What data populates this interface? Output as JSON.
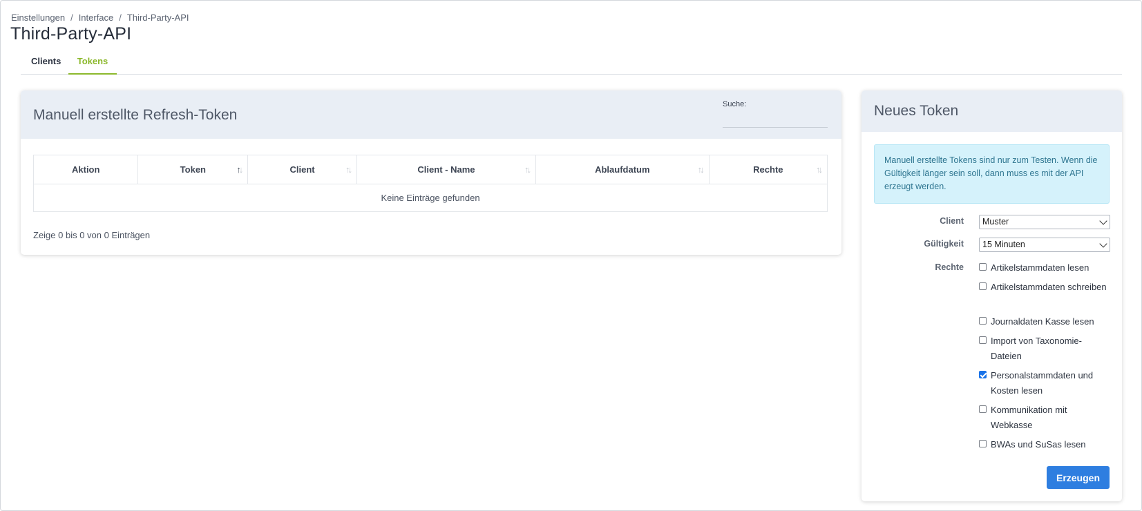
{
  "breadcrumb": [
    "Einstellungen",
    "Interface",
    "Third-Party-API"
  ],
  "page_title": "Third-Party-API",
  "tabs": [
    {
      "label": "Clients",
      "active": false
    },
    {
      "label": "Tokens",
      "active": true
    }
  ],
  "colors": {
    "accent_green": "#8cb82c",
    "primary_button": "#2e7ee0",
    "card_header_bg": "#e9eef5",
    "info_alert_bg": "#d5f2fb",
    "checkbox_checked": "#1a73e8"
  },
  "tokens_panel": {
    "title": "Manuell erstellte Refresh-Token",
    "search_label": "Suche:",
    "search_value": "",
    "columns": [
      "Aktion",
      "Token",
      "Client",
      "Client - Name",
      "Ablaufdatum",
      "Rechte"
    ],
    "sort_icons": [
      "",
      "sort-asc-icon",
      "sort-icon",
      "sort-icon",
      "sort-icon",
      "sort-icon"
    ],
    "empty_message": "Keine Einträge gefunden",
    "info": "Zeige 0 bis 0 von 0 Einträgen"
  },
  "new_token": {
    "title": "Neues Token",
    "alert": "Manuell erstellte Tokens sind nur zum Testen. Wenn die Gültigkeit länger sein soll, dann muss es mit der API erzeugt werden.",
    "client_label": "Client",
    "client_value": "Muster",
    "validity_label": "Gültigkeit",
    "validity_value": "15 Minuten",
    "rights_label": "Rechte",
    "rights": [
      {
        "label": "Artikelstammdaten lesen",
        "checked": false
      },
      {
        "label": "Artikelstammdaten schreiben",
        "checked": false
      },
      {
        "label": "Journaldaten Kasse lesen",
        "checked": false
      },
      {
        "label": "Import von Taxonomie-Dateien",
        "checked": false
      },
      {
        "label": "Personalstammdaten und Kosten lesen",
        "checked": true
      },
      {
        "label": "Kommunikation mit Webkasse",
        "checked": false
      },
      {
        "label": "BWAs und SuSas lesen",
        "checked": false
      }
    ],
    "submit_label": "Erzeugen"
  }
}
